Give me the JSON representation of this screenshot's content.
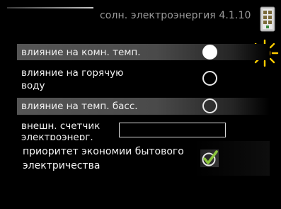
{
  "header": {
    "title": "солн. электроэнергия 4.1.10",
    "panel_icon": "solar-panel-icon"
  },
  "status": {
    "sun_icon": "sun-icon"
  },
  "settings": [
    {
      "label": "влияние на комн. темп.",
      "checked": true
    },
    {
      "label": "влияние на горячую\nводу",
      "checked": false
    },
    {
      "label": "влияние на темп. басс.",
      "checked": false
    }
  ],
  "meter": {
    "label": "внешн. счетчик\nэлектроэнерг.",
    "value": ""
  },
  "priority": {
    "label": "приоритет экономии бытового\nэлектричества",
    "checked": true
  },
  "colors": {
    "check_green": "#8dc63f",
    "sun_yellow": "#ffcc00",
    "row_gray": "#555555"
  }
}
